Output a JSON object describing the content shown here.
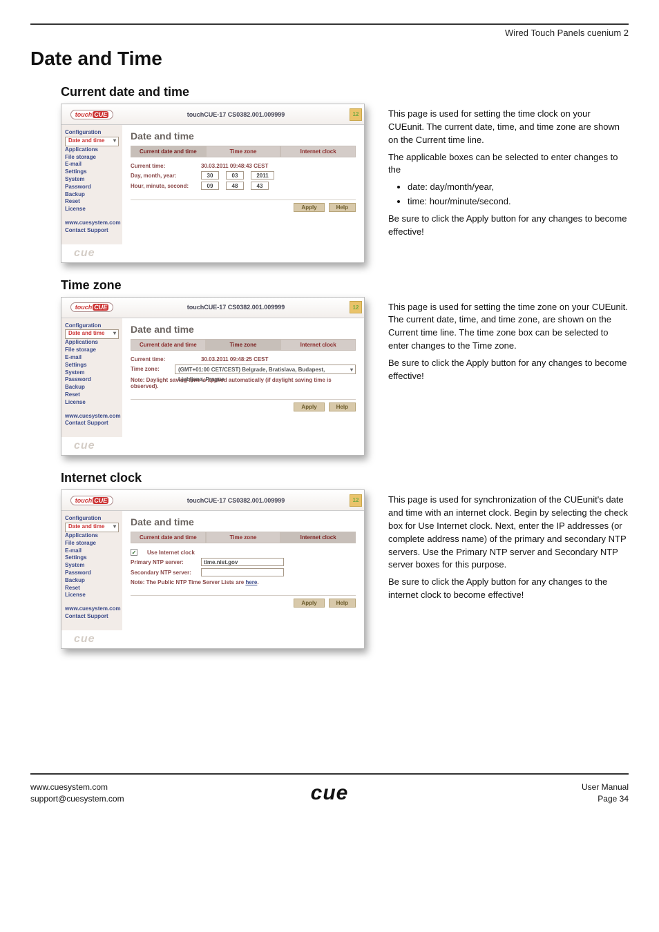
{
  "header_right": "Wired Touch Panels cuenium 2",
  "h1": "Date and Time",
  "sections": {
    "current": {
      "heading": "Current date and time",
      "desc": [
        "This page is used for setting the time clock on your CUEunit. The current date, time, and time zone are shown on the Current time line.",
        "The applicable boxes can be selected to enter changes to the"
      ],
      "bullets": [
        "date: day/month/year,",
        "time: hour/minute/second."
      ],
      "closing": "Be sure to click the Apply button for any changes to become effective!"
    },
    "timezone": {
      "heading": "Time zone",
      "desc": [
        "This page is used for setting the time zone on your CUEunit. The current date, time, and time zone, are shown on the Current time line. The time zone box can be selected to enter changes to the Time zone.",
        "Be sure to click the Apply button for any changes to become effective!"
      ]
    },
    "internet": {
      "heading": "Internet clock",
      "desc": [
        "This page is used for synchronization of the CUEunit's date and time with an internet clock. Begin by selecting the check box for Use Internet clock. Next, enter the IP addresses (or complete address name) of the primary and secondary NTP servers. Use the Primary NTP server and Secondary NTP server boxes for this purpose.",
        "Be sure to click the Apply button for any changes to the internet clock to become effective!"
      ]
    }
  },
  "screenshot": {
    "title": "touchCUE-17   CS0382.001.009999",
    "version_badge": "12",
    "logo_main": "touch",
    "logo_hl": "CUE",
    "sidebar": {
      "items": [
        "Configuration",
        "Date and time",
        "Applications",
        "File storage",
        "E-mail",
        "Settings",
        "System",
        "Password",
        "Backup",
        "Reset",
        "License"
      ],
      "links": [
        "www.cuesystem.com",
        "Contact Support"
      ]
    },
    "panel_title": "Date and time",
    "tabs": [
      "Current date and time",
      "Time zone",
      "Internet clock"
    ],
    "current_panel": {
      "current_time_label": "Current time:",
      "current_time_value": "30.03.2011   09:48:43   CEST",
      "dmy_label": "Day, month, year:",
      "dmy": [
        "30",
        "03",
        "2011"
      ],
      "hms_label": "Hour, minute, second:",
      "hms": [
        "09",
        "48",
        "43"
      ]
    },
    "timezone_panel": {
      "current_time_label": "Current time:",
      "current_time_value": "30.03.2011   09:48:25   CEST",
      "tz_label": "Time zone:",
      "tz_value": "(GMT+01:00 CET/CEST) Belgrade, Bratislava, Budapest, Ljubljana, Prague",
      "note": "Note: Daylight saving time is applied automatically (if daylight saving time is observed)."
    },
    "internet_panel": {
      "chk_label": "Use Internet clock",
      "primary_label": "Primary NTP server:",
      "primary_value": "time.nist.gov",
      "secondary_label": "Secondary NTP server:",
      "note_pre": "Note: The Public NTP Time Server Lists are ",
      "note_link": "here",
      "note_post": "."
    },
    "buttons": {
      "apply": "Apply",
      "help": "Help"
    },
    "brand_bottom": "cue"
  },
  "footer": {
    "left1": "www.cuesystem.com",
    "left2": "support@cuesystem.com",
    "logo": "cue",
    "right1": "User Manual",
    "right2": "Page 34"
  }
}
